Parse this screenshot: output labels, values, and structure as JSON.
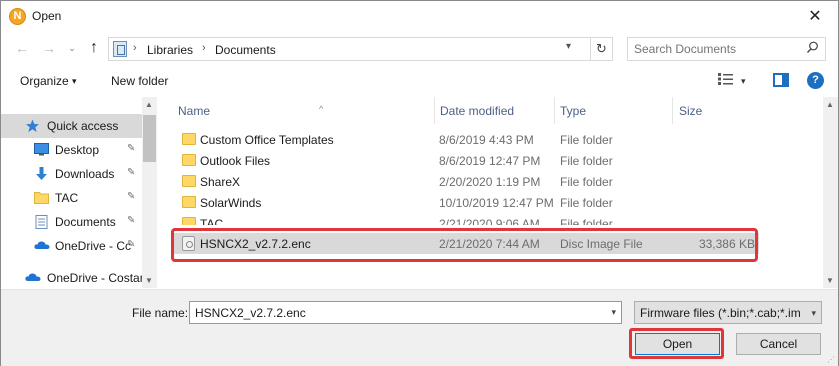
{
  "window": {
    "title": "Open",
    "app_icon_letter": "N",
    "close_symbol": "✕"
  },
  "navigation": {
    "back_symbol": "←",
    "forward_symbol": "→",
    "recent_symbol": "⌄",
    "up_symbol": "↑",
    "breadcrumb": [
      "Libraries",
      "Documents"
    ],
    "separator": "›",
    "refresh_symbol": "↻",
    "search_placeholder": "Search Documents"
  },
  "toolbar": {
    "organize_label": "Organize",
    "new_folder_label": "New folder",
    "caret": "▾",
    "help_symbol": "?"
  },
  "sidebar": {
    "items": [
      {
        "label": "Quick access",
        "icon": "star-icon",
        "pinned": false,
        "selected": true
      },
      {
        "label": "Desktop",
        "icon": "desktop-icon",
        "pinned": true,
        "selected": false
      },
      {
        "label": "Downloads",
        "icon": "download-icon",
        "pinned": true,
        "selected": false
      },
      {
        "label": "TAC",
        "icon": "folder-icon",
        "pinned": true,
        "selected": false
      },
      {
        "label": "Documents",
        "icon": "documents-icon",
        "pinned": true,
        "selected": false
      },
      {
        "label": "OneDrive - Cc",
        "icon": "onedrive-icon",
        "pinned": true,
        "selected": false
      },
      {
        "label": "OneDrive - Costar",
        "icon": "onedrive-icon",
        "pinned": false,
        "selected": false
      }
    ],
    "pin_symbol": "📌"
  },
  "columns": {
    "name": "Name",
    "date_modified": "Date modified",
    "type": "Type",
    "size": "Size",
    "sort_symbol": "^"
  },
  "files": [
    {
      "name": "Custom Office Templates",
      "date": "8/6/2019 4:43 PM",
      "type": "File folder",
      "size": "",
      "kind": "folder"
    },
    {
      "name": "Outlook Files",
      "date": "8/6/2019 12:47 PM",
      "type": "File folder",
      "size": "",
      "kind": "folder"
    },
    {
      "name": "ShareX",
      "date": "2/20/2020 1:19 PM",
      "type": "File folder",
      "size": "",
      "kind": "folder"
    },
    {
      "name": "SolarWinds",
      "date": "10/10/2019 12:47 PM",
      "type": "File folder",
      "size": "",
      "kind": "folder"
    },
    {
      "name": "TAC",
      "date": "2/21/2020 9:06 AM",
      "type": "File folder",
      "size": "",
      "kind": "folder"
    },
    {
      "name": "HSNCX2_v2.7.2.enc",
      "date": "2/21/2020 7:44 AM",
      "type": "Disc Image File",
      "size": "33,386 KB",
      "kind": "disc"
    }
  ],
  "footer": {
    "file_name_label": "File name:",
    "file_name_value": "HSNCX2_v2.7.2.enc",
    "filter_value": "Firmware files (*.bin;*.cab;*.img",
    "open_label": "Open",
    "cancel_label": "Cancel"
  },
  "colors": {
    "highlight": "#e0353a",
    "accent": "#0078d7"
  }
}
